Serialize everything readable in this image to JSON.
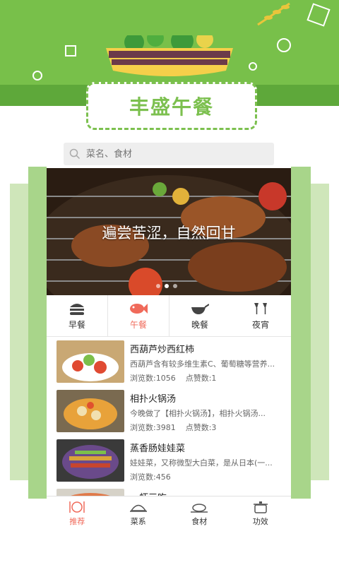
{
  "header": {
    "title": "丰盛午餐"
  },
  "search": {
    "placeholder": "菜名、食材"
  },
  "banner": {
    "caption": "遍尝苦涩，自然回甘",
    "dots": 3,
    "active_dot": 1
  },
  "tabs": [
    {
      "label": "早餐",
      "icon": "burger-icon"
    },
    {
      "label": "午餐",
      "icon": "fish-icon",
      "active": true
    },
    {
      "label": "晚餐",
      "icon": "wok-icon"
    },
    {
      "label": "夜宵",
      "icon": "wine-glasses-icon"
    }
  ],
  "list": [
    {
      "title": "西葫芦炒西红柿",
      "desc": "西葫芦含有较多维生素C、葡萄糖等营养...",
      "views_label": "浏览数:1056",
      "likes_label": "点赞数:1"
    },
    {
      "title": "相扑火锅汤",
      "desc": "今晚做了【相扑火锅汤】，相扑火锅汤...",
      "views_label": "浏览数:3981",
      "likes_label": "点赞数:3"
    },
    {
      "title": "蒸香肠娃娃菜",
      "desc": "娃娃菜，又称微型大白菜，是从日本(一...",
      "views_label": "浏览数:456",
      "likes_label": ""
    },
    {
      "title": "一虾三吃",
      "desc": "",
      "views_label": "",
      "likes_label": ""
    }
  ],
  "bottom_nav": [
    {
      "label": "推荐",
      "icon": "dining-icon",
      "active": true
    },
    {
      "label": "菜系",
      "icon": "cloche-icon"
    },
    {
      "label": "食材",
      "icon": "chicken-dish-icon"
    },
    {
      "label": "功效",
      "icon": "pot-icon"
    }
  ],
  "colors": {
    "brand_green": "#78c04a",
    "accent_red": "#f06a5a"
  }
}
